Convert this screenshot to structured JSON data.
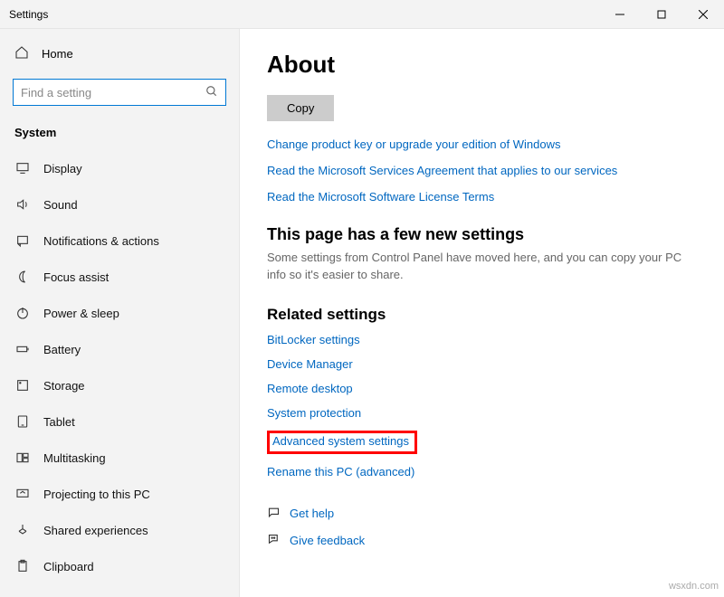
{
  "window": {
    "title": "Settings"
  },
  "sidebar": {
    "home_label": "Home",
    "search_placeholder": "Find a setting",
    "section_label": "System",
    "items": [
      {
        "label": "Display",
        "icon": "display-icon"
      },
      {
        "label": "Sound",
        "icon": "sound-icon"
      },
      {
        "label": "Notifications & actions",
        "icon": "notifications-icon"
      },
      {
        "label": "Focus assist",
        "icon": "moon-icon"
      },
      {
        "label": "Power & sleep",
        "icon": "power-icon"
      },
      {
        "label": "Battery",
        "icon": "battery-icon"
      },
      {
        "label": "Storage",
        "icon": "storage-icon"
      },
      {
        "label": "Tablet",
        "icon": "tablet-icon"
      },
      {
        "label": "Multitasking",
        "icon": "multitasking-icon"
      },
      {
        "label": "Projecting to this PC",
        "icon": "project-icon"
      },
      {
        "label": "Shared experiences",
        "icon": "share-icon"
      },
      {
        "label": "Clipboard",
        "icon": "clipboard-icon"
      }
    ]
  },
  "main": {
    "title": "About",
    "copy_label": "Copy",
    "links": [
      "Change product key or upgrade your edition of Windows",
      "Read the Microsoft Services Agreement that applies to our services",
      "Read the Microsoft Software License Terms"
    ],
    "new_settings": {
      "heading": "This page has a few new settings",
      "desc": "Some settings from Control Panel have moved here, and you can copy your PC info so it's easier to share."
    },
    "related": {
      "heading": "Related settings",
      "links": [
        "BitLocker settings",
        "Device Manager",
        "Remote desktop",
        "System protection",
        "Advanced system settings",
        "Rename this PC (advanced)"
      ],
      "highlighted_index": 4
    },
    "bottom": {
      "get_help": "Get help",
      "give_feedback": "Give feedback"
    }
  },
  "watermark": "wsxdn.com"
}
